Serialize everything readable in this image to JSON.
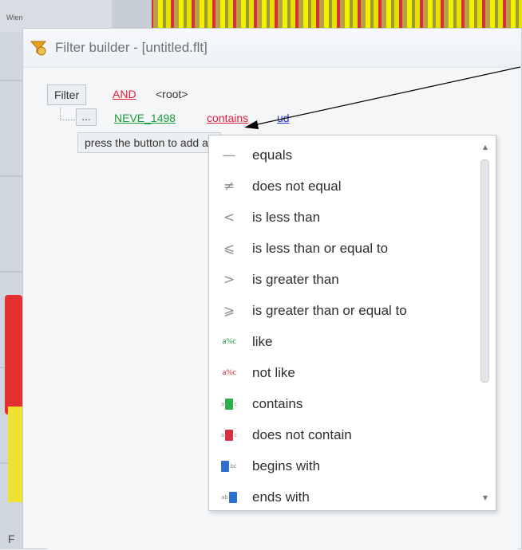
{
  "window": {
    "title": "Filter builder - [untitled.flt]",
    "map_label": "Wien",
    "left_strip_char": "F"
  },
  "filter": {
    "root_button": "Filter",
    "group_operator": "AND",
    "root_label": "<root>",
    "condition": {
      "ellipsis": "...",
      "field": "NEVE_1498",
      "operator": "contains",
      "value": "ud"
    },
    "hint": "press the button to add a new condition"
  },
  "operator_menu": {
    "items": [
      {
        "icon": "equals-icon",
        "label": "equals"
      },
      {
        "icon": "not-equal-icon",
        "label": "does not equal"
      },
      {
        "icon": "less-than-icon",
        "label": "is less than"
      },
      {
        "icon": "less-equal-icon",
        "label": "is less than or equal to"
      },
      {
        "icon": "greater-than-icon",
        "label": "is greater than"
      },
      {
        "icon": "greater-equal-icon",
        "label": "is greater than or equal to"
      },
      {
        "icon": "like-icon",
        "label": "like"
      },
      {
        "icon": "not-like-icon",
        "label": "not like"
      },
      {
        "icon": "contains-icon",
        "label": "contains"
      },
      {
        "icon": "not-contains-icon",
        "label": "does not contain"
      },
      {
        "icon": "begins-with-icon",
        "label": "begins with"
      },
      {
        "icon": "ends-with-icon",
        "label": "ends with"
      }
    ]
  },
  "colors": {
    "operator_red": "#e0203a",
    "field_green": "#1a9a3a",
    "value_blue": "#2a3ad0"
  }
}
